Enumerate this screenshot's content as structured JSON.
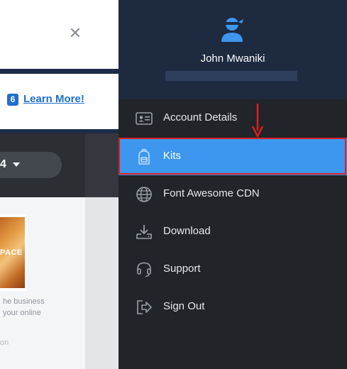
{
  "background_page": {
    "close_icon": "close-icon",
    "learn_badge": "6",
    "learn_more": "Learn More!",
    "version_label": "4",
    "thumbnail_text": "PACE",
    "description_lines": [
      "he business",
      "your online",
      "on"
    ]
  },
  "panel": {
    "user_name": "John Mwaniki",
    "avatar_icon": "user-ninja-icon",
    "menu": [
      {
        "label": "Account Details",
        "icon": "address-card-icon",
        "active": false
      },
      {
        "label": "Kits",
        "icon": "backpack-icon",
        "active": true
      },
      {
        "label": "Font Awesome CDN",
        "icon": "globe-icon",
        "active": false
      },
      {
        "label": "Download",
        "icon": "download-icon",
        "active": false
      },
      {
        "label": "Support",
        "icon": "headset-icon",
        "active": false
      },
      {
        "label": "Sign Out",
        "icon": "sign-out-icon",
        "active": false
      }
    ]
  },
  "annotation": {
    "color": "#e01e1e"
  },
  "colors": {
    "panel_bg": "#212428",
    "profile_bg": "#1d2a40",
    "active_bg": "#3d97ef",
    "link_blue": "#1f6fcf"
  }
}
